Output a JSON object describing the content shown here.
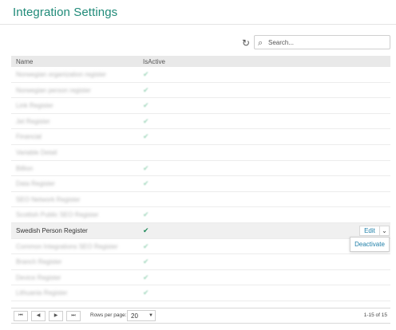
{
  "header": {
    "title": "Integration Settings"
  },
  "toolbar": {
    "refresh_icon": "refresh-icon",
    "search_icon": "search-icon",
    "search_placeholder": "Search..."
  },
  "table": {
    "columns": {
      "name": "Name",
      "is_active": "IsActive"
    },
    "rows": [
      {
        "name": "Norwegian organization register",
        "active": true
      },
      {
        "name": "Norwegian person register",
        "active": true
      },
      {
        "name": "Link Register",
        "active": true
      },
      {
        "name": "Jet Register",
        "active": true
      },
      {
        "name": "Financial",
        "active": true
      },
      {
        "name": "Variable Detail",
        "active": false
      },
      {
        "name": "Billion",
        "active": true
      },
      {
        "name": "Data Register",
        "active": true
      },
      {
        "name": "SEO Network Register",
        "active": false
      },
      {
        "name": "Scottish Public SEO Register",
        "active": true
      },
      {
        "name": "Swedish Person Register",
        "active": true
      },
      {
        "name": "Common Integrations SEO Register",
        "active": true
      },
      {
        "name": "Branch Register",
        "active": true
      },
      {
        "name": "Device Register",
        "active": true
      },
      {
        "name": "Lithuania Register",
        "active": true
      }
    ],
    "active_mark": "✔",
    "selected_row": {
      "edit_label": "Edit",
      "menu_toggle_icon": "chevron-down-icon",
      "menu_item": "Deactivate"
    }
  },
  "pagination": {
    "first_icon": "first-page-icon",
    "prev_icon": "previous-page-icon",
    "next_icon": "next-page-icon",
    "last_icon": "last-page-icon",
    "rows_per_page_label": "Rows per page:",
    "rows_per_page_value": "20",
    "page_info": "1-15 of 15"
  },
  "colors": {
    "accent": "#1f8a78",
    "link": "#1f7fa8",
    "check": "#1f8a5a"
  }
}
